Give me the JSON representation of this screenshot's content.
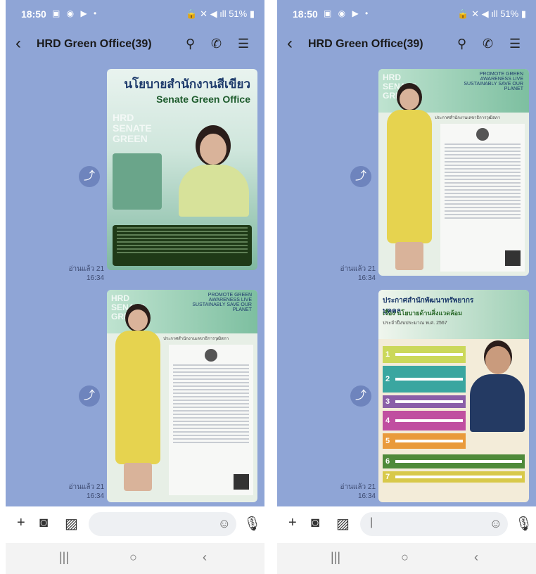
{
  "screens": [
    {
      "status": {
        "time": "18:50",
        "battery": "51%"
      },
      "header": {
        "title": "HRD Green Office(39)"
      },
      "messages": [
        {
          "poster": {
            "title_th": "นโยบายสำนักงานสีเขียว",
            "title_en": "Senate Green Office",
            "watermark": "HRD SENATE GREEN"
          },
          "read_label": "อ่านแล้ว 21",
          "time": "16:34"
        },
        {
          "poster": {
            "tagline": "PROMOTE GREEN AWARENESS LIVE SUSTAINABLY SAVE OUR PLANET",
            "watermark": "HRD SENATE GREEN",
            "announce": "ประกาศสำนักงานเลขาธิการวุฒิสภา"
          },
          "read_label": "อ่านแล้ว 21",
          "time": "16:34"
        }
      ]
    },
    {
      "status": {
        "time": "18:50",
        "battery": "51%"
      },
      "header": {
        "title": "HRD Green Office(39)"
      },
      "messages": [
        {
          "poster": {
            "tagline": "PROMOTE GREEN AWARENESS LIVE SUSTAINABLY SAVE OUR PLANET",
            "watermark": "HRD SENATE GREEN",
            "announce": "ประกาศสำนักงานเลขาธิการวุฒิสภา"
          },
          "read_label": "อ่านแล้ว 21",
          "time": "16:34"
        },
        {
          "poster": {
            "title_th": "ประกาศสำนักพัฒนาทรัพยากรบุคคล",
            "subtitle": "เรื่อง นโยบายด้านสิ่งแวดล้อม",
            "year": "ประจำปีงบประมาณ พ.ศ. 2567",
            "items": [
              "1",
              "2",
              "3",
              "4",
              "5",
              "6",
              "7"
            ]
          },
          "read_label": "อ่านแล้ว 21",
          "time": "16:34"
        }
      ]
    }
  ],
  "colors": {
    "chat_bg": "#8fa5d6",
    "accent_green": "#4f8a3a",
    "dark_green": "#1f3a17"
  },
  "icons": {
    "back": "chevron-left-icon",
    "search": "search-icon",
    "call": "phone-icon",
    "menu": "menu-icon",
    "share": "share-icon",
    "add": "plus-icon",
    "camera": "camera-icon",
    "image": "image-icon",
    "emoji": "emoji-icon",
    "mic": "mic-icon"
  }
}
